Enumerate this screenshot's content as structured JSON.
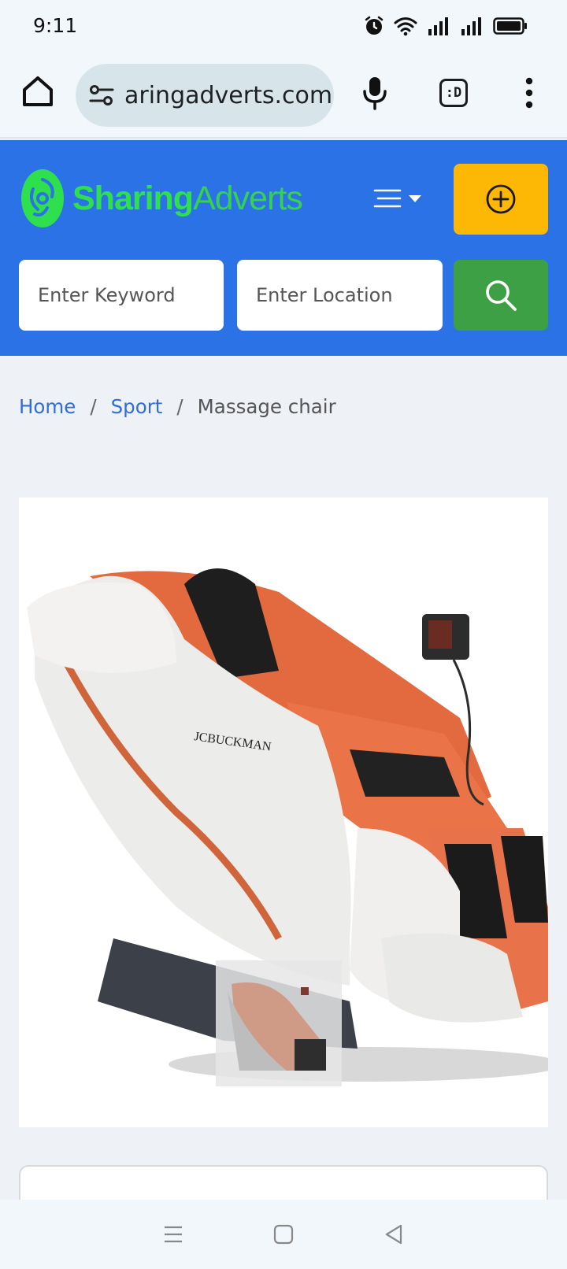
{
  "status_bar": {
    "time": "9:11",
    "icons": [
      "alarm-icon",
      "wifi-icon",
      "signal-icon",
      "signal-icon",
      "battery-icon"
    ]
  },
  "browser": {
    "url": "aringadverts.com",
    "tab_switcher_label": ":D"
  },
  "site": {
    "logo_part1": "Sharing",
    "logo_part2": "Adverts",
    "brand_colors": {
      "header": "#2b72e7",
      "logo": "#2ee04d",
      "post_ad": "#fdb705",
      "search": "#3ea045"
    },
    "search": {
      "keyword_placeholder": "Enter Keyword",
      "location_placeholder": "Enter Location"
    }
  },
  "breadcrumb": {
    "home": "Home",
    "category": "Sport",
    "current": "Massage chair",
    "separator": "/"
  },
  "product": {
    "chair_brand": "JCBUCKMAN"
  }
}
